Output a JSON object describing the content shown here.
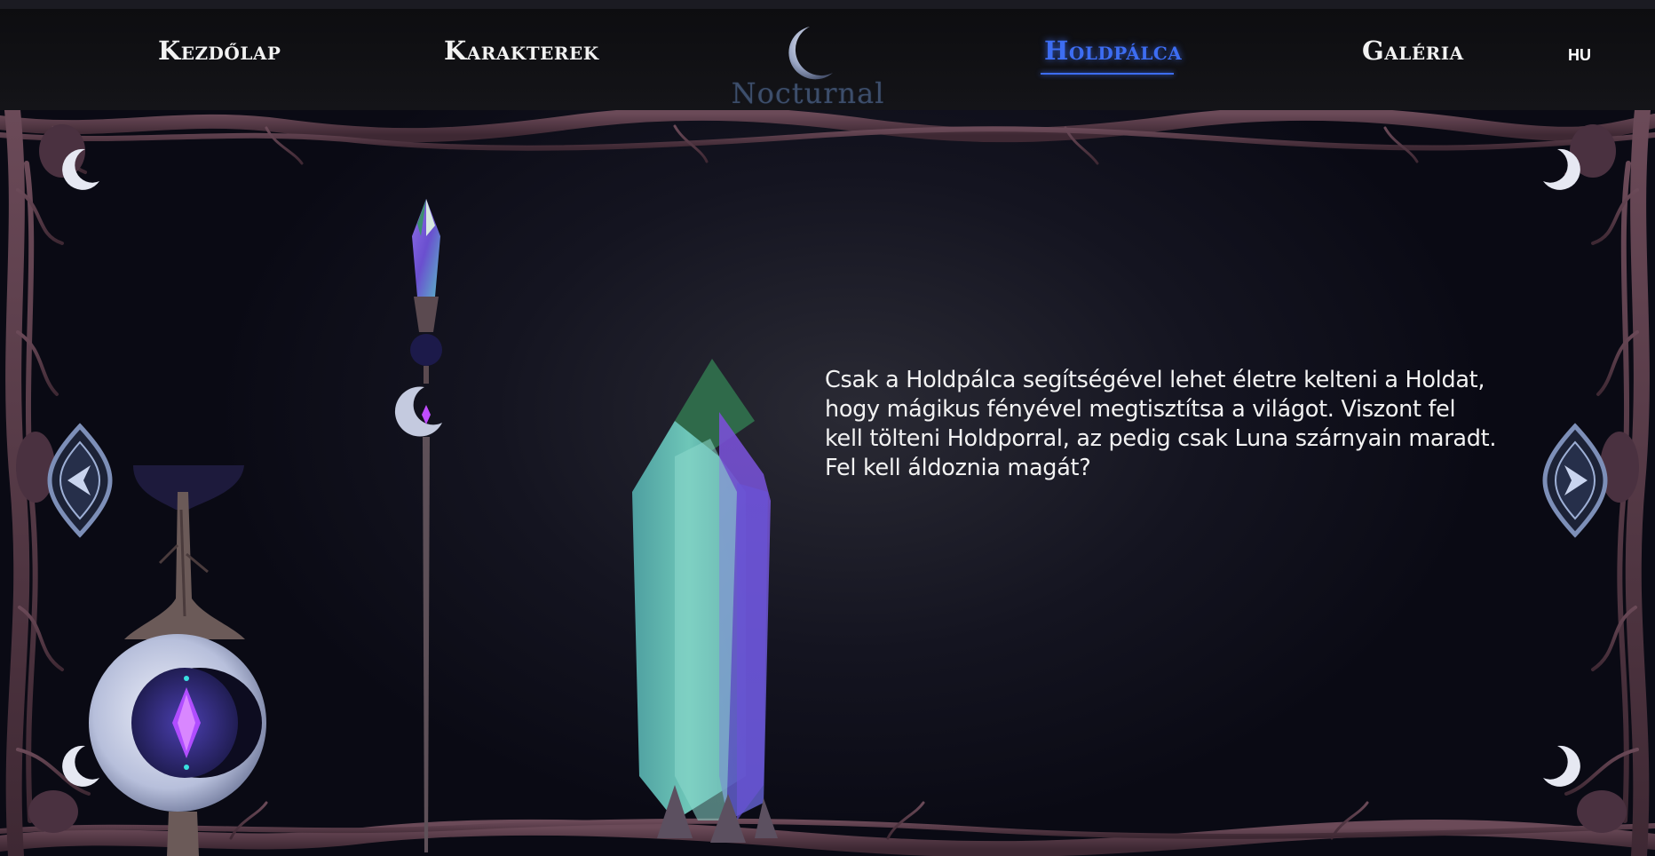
{
  "nav": {
    "items": [
      {
        "label": "Kezdőlap",
        "active": false
      },
      {
        "label": "Karakterek",
        "active": false
      },
      {
        "label": "Holdpálca",
        "active": true
      },
      {
        "label": "Galéria",
        "active": false
      }
    ],
    "language": "HU",
    "logo_text": "Nocturnal"
  },
  "content": {
    "description": "Csak a Holdpálca segítségével lehet életre kelteni a Holdat, hogy mágikus fényével megtisztítsa a világot. Viszont fel kell tölteni Holdporral, az pedig csak Luna szárnyain maradt. Fel kell áldoznia magát?"
  },
  "colors": {
    "accent": "#3d6df2",
    "frame_branch": "#5a3a48",
    "background": "#0a0a14",
    "crystal_teal": "#6ec6b8",
    "crystal_purple": "#7a4fd6"
  },
  "icons": {
    "left": "chevron-left-icon",
    "right": "chevron-right-icon",
    "corner": "crescent-moon-icon"
  }
}
